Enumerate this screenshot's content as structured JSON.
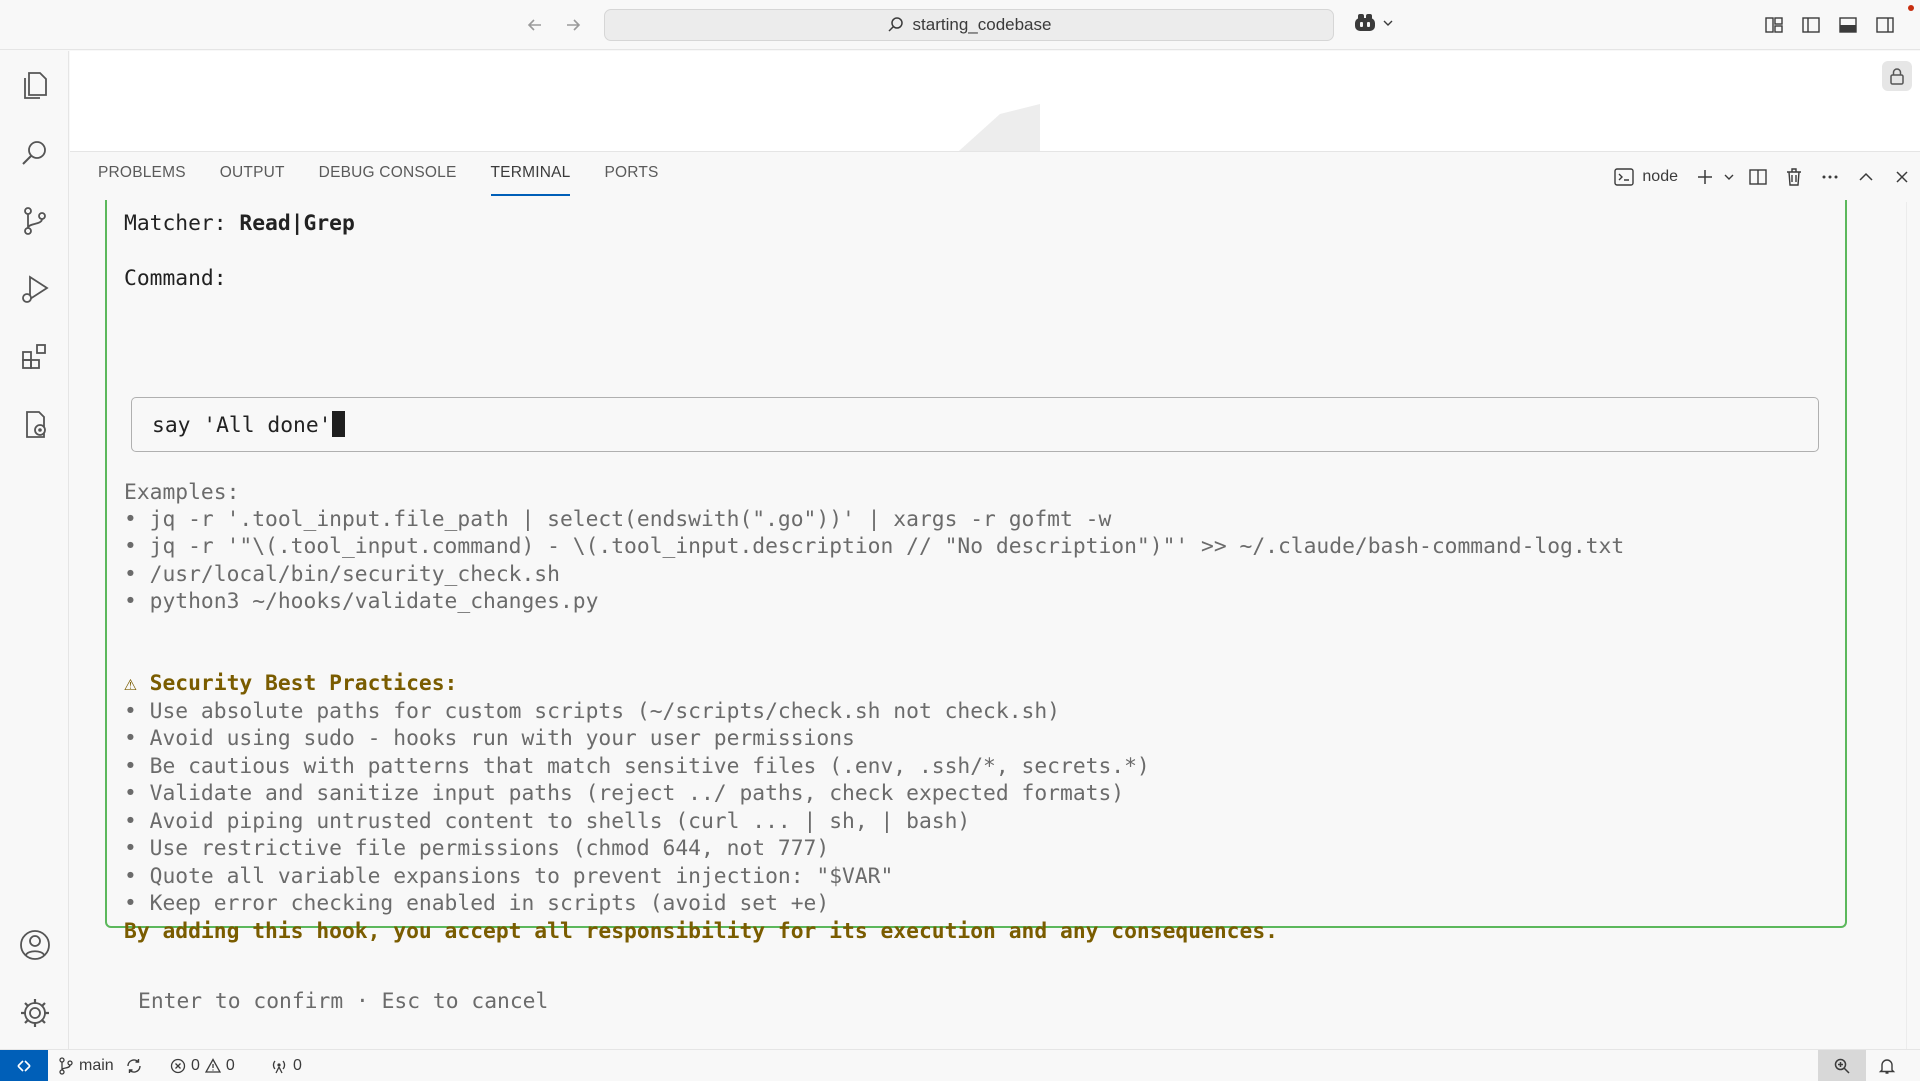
{
  "titlebar": {
    "search_text": "starting_codebase"
  },
  "panel": {
    "tabs": [
      "PROBLEMS",
      "OUTPUT",
      "DEBUG CONSOLE",
      "TERMINAL",
      "PORTS"
    ],
    "active_tab": "TERMINAL",
    "terminal_name": "node"
  },
  "terminal": {
    "matcher_label": "Matcher: ",
    "matcher_value": "Read|Grep",
    "command_label": "Command:",
    "command_value": "say 'All done'",
    "examples_header": "Examples:",
    "examples": [
      "• jq -r '.tool_input.file_path | select(endswith(\".go\"))' | xargs -r gofmt -w",
      "• jq -r '\"\\(.tool_input.command) - \\(.tool_input.description // \"No description\")\"' >> ~/.claude/bash-command-log.txt",
      "• /usr/local/bin/security_check.sh",
      "• python3 ~/hooks/validate_changes.py"
    ],
    "security_header": "⚠ Security Best Practices:",
    "security_items": [
      "• Use absolute paths for custom scripts (~/scripts/check.sh not check.sh)",
      "• Avoid using sudo - hooks run with your user permissions",
      "• Be cautious with patterns that match sensitive files (.env, .ssh/*, secrets.*)",
      "• Validate and sanitize input paths (reject ../ paths, check expected formats)",
      "• Avoid piping untrusted content to shells (curl ... | sh, | bash)",
      "• Use restrictive file permissions (chmod 644, not 777)",
      "• Quote all variable expansions to prevent injection: \"$VAR\"",
      "• Keep error checking enabled in scripts (avoid set +e)"
    ],
    "accept_text": "By adding this hook, you accept all responsibility for its execution and any consequences.",
    "hint": "Enter to confirm · Esc to cancel"
  },
  "statusbar": {
    "branch": "main",
    "errors": "0",
    "warnings": "0",
    "ports": "0"
  },
  "colors": {
    "accent": "#005fb8",
    "box_border": "#5cb85c",
    "warning_text": "#7a5c00"
  }
}
